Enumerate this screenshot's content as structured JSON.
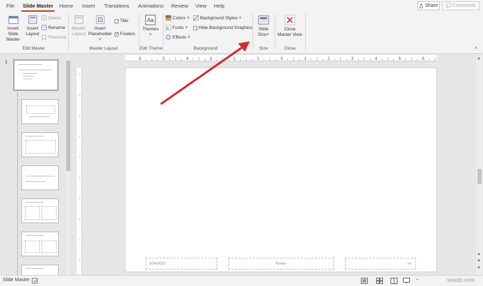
{
  "tabs": {
    "file": "File",
    "slide_master": "Slide Master",
    "home": "Home",
    "insert": "Insert",
    "transitions": "Transitions",
    "animations": "Animations",
    "review": "Review",
    "view": "View",
    "help": "Help"
  },
  "top_right": {
    "share": "Share",
    "comments": "Comments"
  },
  "ribbon": {
    "edit_master": {
      "insert_slide_master_1": "Insert Slide",
      "insert_slide_master_2": "Master",
      "insert_layout_1": "Insert",
      "insert_layout_2": "Layout",
      "delete": "Delete",
      "rename": "Rename",
      "preserve": "Preserve",
      "group_label": "Edit Master"
    },
    "master_layout": {
      "master_layout_1": "Master",
      "master_layout_2": "Layout",
      "insert_placeholder_1": "Insert",
      "insert_placeholder_2": "Placeholder",
      "title": "Title",
      "footers": "Footers",
      "group_label": "Master Layout"
    },
    "edit_theme": {
      "themes": "Themes",
      "group_label": "Edit Theme"
    },
    "background": {
      "colors": "Colors",
      "fonts": "Fonts",
      "effects": "Effects",
      "background_styles": "Background Styles",
      "hide_background_graphics": "Hide Background Graphics",
      "group_label": "Background"
    },
    "size": {
      "slide_size_1": "Slide",
      "slide_size_2": "Size",
      "group_label": "Size"
    },
    "close": {
      "close_master_view_1": "Close",
      "close_master_view_2": "Master View",
      "group_label": "Close"
    }
  },
  "thumbnails": {
    "slide_number": "1"
  },
  "slide": {
    "date": "3/24/2021",
    "footer": "Footer",
    "slide_number": "‹#›"
  },
  "ruler": {
    "h_ticks": [
      "6",
      "5",
      "4",
      "3",
      "2",
      "1",
      "0",
      "1",
      "2",
      "3",
      "4",
      "5",
      "6"
    ]
  },
  "status": {
    "view_name": "Slide Master"
  },
  "watermark": "wsxdn.com",
  "colors": {
    "accent": "#c43e1c",
    "arrow": "#d42a2a",
    "close_icon": "#d13438"
  }
}
